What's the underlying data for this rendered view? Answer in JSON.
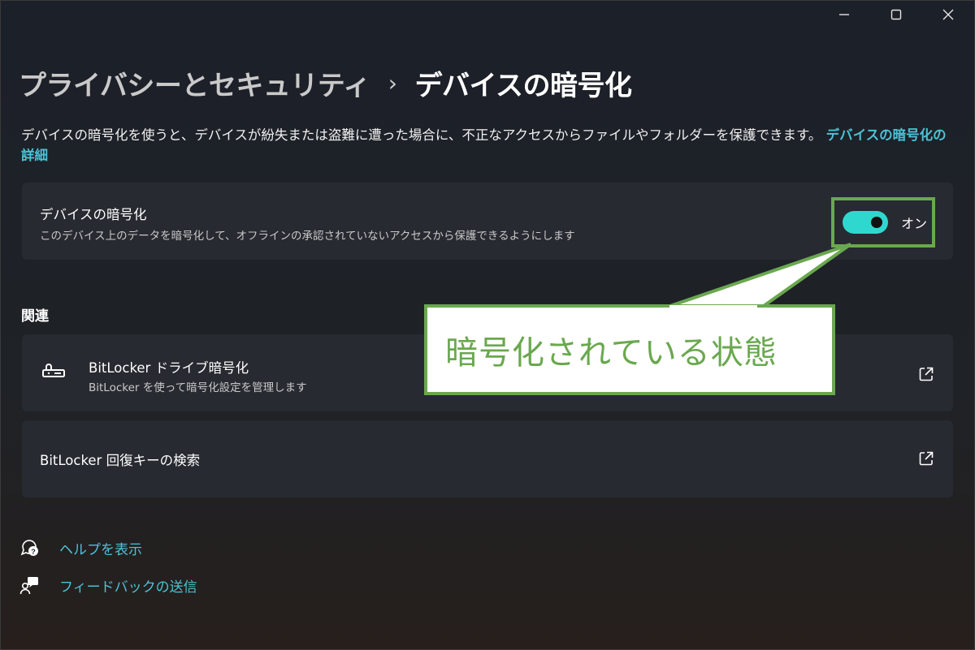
{
  "window": {
    "controls": {
      "minimize_icon": "minimize-icon",
      "maximize_icon": "maximize-icon",
      "close_icon": "close-icon"
    }
  },
  "breadcrumb": {
    "parent": "プライバシーとセキュリティ",
    "separator": "›",
    "current": "デバイスの暗号化"
  },
  "intro": {
    "text": "デバイスの暗号化を使うと、デバイスが紛失または盗難に遭った場合に、不正なアクセスからファイルやフォルダーを保護できます。",
    "link": "デバイスの暗号化の詳細"
  },
  "encryption_card": {
    "title": "デバイスの暗号化",
    "subtitle": "このデバイス上のデータを暗号化して、オフラインの承認されていないアクセスから保護できるようにします",
    "toggle": {
      "state": "on",
      "label": "オン"
    }
  },
  "related": {
    "heading": "関連",
    "items": [
      {
        "title": "BitLocker ドライブ暗号化",
        "subtitle": "BitLocker を使って暗号化設定を管理します",
        "icon": "bitlocker-key-icon",
        "action_icon": "external-link-icon"
      },
      {
        "title": "BitLocker 回復キーの検索",
        "action_icon": "external-link-icon"
      }
    ]
  },
  "callout": {
    "text": "暗号化されている状態"
  },
  "footer": {
    "help": {
      "label": "ヘルプを表示",
      "icon": "help-chat-icon"
    },
    "feedback": {
      "label": "フィードバックの送信",
      "icon": "feedback-icon"
    }
  },
  "colors": {
    "accent": "#2fd8cf",
    "link": "#4cc2d6",
    "callout_border": "#6aa84f",
    "card_bg": "#272a31"
  }
}
